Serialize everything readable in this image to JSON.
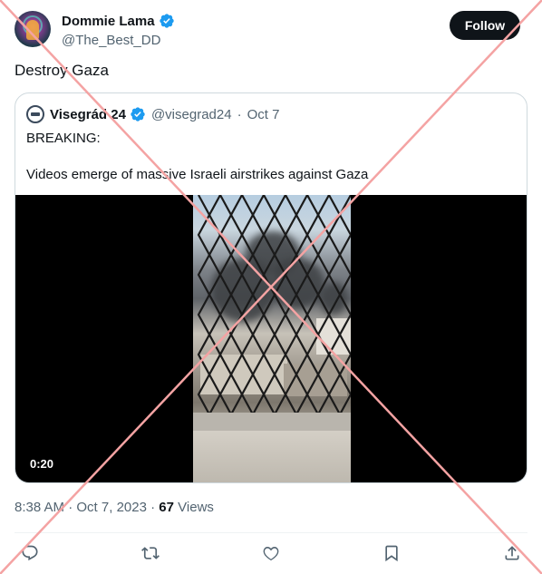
{
  "author": {
    "display_name": "Dommie Lama",
    "handle": "@The_Best_DD",
    "verified": true
  },
  "follow_label": "Follow",
  "tweet": {
    "text": "Destroy Gaza",
    "time": "8:38 AM",
    "date": "Oct 7, 2023",
    "separator": " · ",
    "views_count": "67",
    "views_label": "Views"
  },
  "quote": {
    "display_name": "Visegrád 24",
    "handle": "@visegrad24",
    "date": "Oct 7",
    "separator": "·",
    "text": "BREAKING:\n\nVideos emerge of massive Israeli airstrikes against Gaza",
    "video_duration": "0:20"
  },
  "colors": {
    "verified_blue": "#1d9bf0",
    "text_primary": "#0f1419",
    "text_secondary": "#536471",
    "overlay_cross": "#f4a3a3"
  },
  "icons": [
    "verified-badge-icon",
    "reply-icon",
    "retweet-icon",
    "like-icon",
    "bookmark-icon",
    "share-icon"
  ]
}
